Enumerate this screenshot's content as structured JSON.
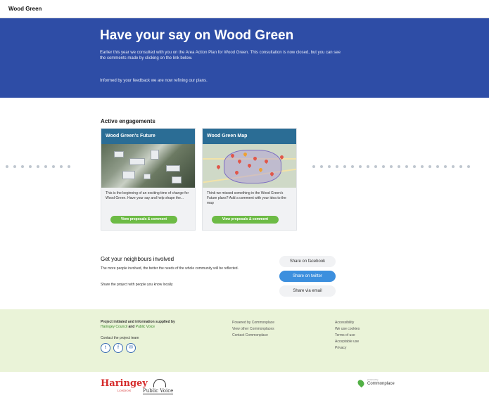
{
  "site": {
    "name": "Wood Green"
  },
  "hero": {
    "title": "Have your say on Wood Green",
    "intro": "Earlier this year we consulted with you on the Area Action Plan for Wood Green. This consultation is now closed, but you can see the comments made by clicking on the link below.",
    "update": "Informed by your feedback we are now refining our plans.",
    "bg_color": "#2e4da6"
  },
  "engagements": {
    "heading": "Active engagements",
    "cards": [
      {
        "title": "Wood Green's Future",
        "desc": "This is the beginning of an exciting time of change for Wood Green. Have your say and help shape the...",
        "button": "View proposals & comment",
        "image": "aerial-photo"
      },
      {
        "title": "Wood Green Map",
        "desc": "Think we missed something in the Wood Green's Future plans? Add a comment with your idea to the map",
        "button": "View proposals & comment",
        "image": "map-with-pins"
      }
    ],
    "header_color": "#2b6d95",
    "button_color": "#6dbb45"
  },
  "neighbours": {
    "title": "Get your neighbours involved",
    "text1": "The more people involved, the better the needs of the whole community will be reflected.",
    "text2": "Share the project with people you know locally",
    "share_facebook": "Share on facebook",
    "share_twitter": "Share on twitter",
    "share_email": "Share via email"
  },
  "footer": {
    "project_text": "Project initiated and information supplied by",
    "partner1": "Haringey Council",
    "and": "and",
    "partner2": "Public Voice",
    "contact": "Contact the project team",
    "social_icons": [
      "twitter-icon",
      "facebook-icon",
      "email-icon"
    ],
    "col2": [
      "Powered by Commonplace",
      "View other Commonplaces",
      "Contact Commonplace"
    ],
    "col3": [
      "Accessibility",
      "We use cookies",
      "Terms of use",
      "Acceptable use",
      "Privacy"
    ],
    "bg_color": "#eaf3d8"
  },
  "logos": {
    "haringey": "Haringey",
    "haringey_sub": "LONDON",
    "public_voice": "Public Voice",
    "powered_small": "powered by",
    "powered_name": "Commonplace"
  }
}
